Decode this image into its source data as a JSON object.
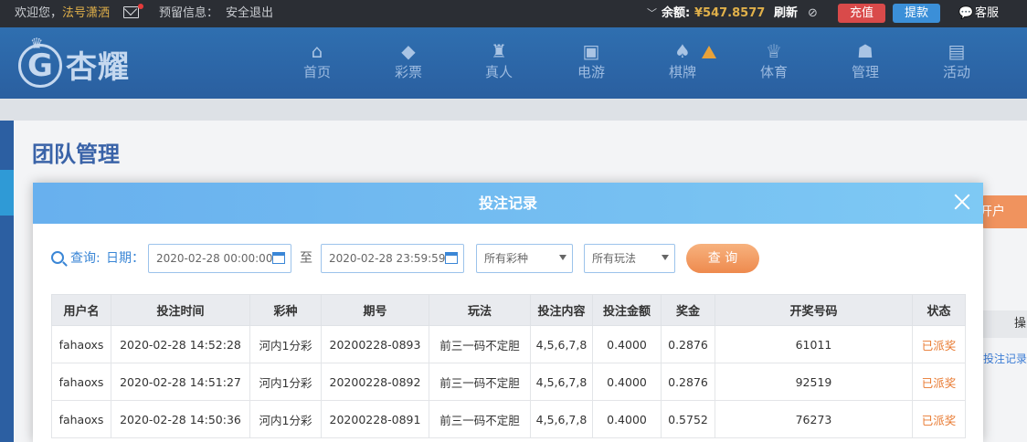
{
  "topbar": {
    "welcome": "欢迎您，",
    "username": "法号潇洒",
    "preview_info": "预留信息：",
    "logout": "安全退出",
    "balance_label": "余额:",
    "balance_value": "¥547.8577",
    "refresh": "刷新",
    "recharge": "充值",
    "withdraw": "提款",
    "service": "客服"
  },
  "logo": {
    "mark": "G",
    "text": "杏耀"
  },
  "nav": [
    {
      "label": "首页",
      "icon": "home-icon",
      "glyph": "⌂"
    },
    {
      "label": "彩票",
      "icon": "lottery-icon",
      "glyph": "◆"
    },
    {
      "label": "真人",
      "icon": "live-dealer-icon",
      "glyph": "♜"
    },
    {
      "label": "电游",
      "icon": "slot-machine-icon",
      "glyph": "▣"
    },
    {
      "label": "棋牌",
      "icon": "cards-icon",
      "glyph": "♠"
    },
    {
      "label": "体育",
      "icon": "trophy-icon",
      "glyph": "♕"
    },
    {
      "label": "管理",
      "icon": "users-icon",
      "glyph": "☗"
    },
    {
      "label": "活动",
      "icon": "gift-icon",
      "glyph": "▤"
    }
  ],
  "page": {
    "title": "团队管理",
    "bg_button": "开户",
    "bg_header": "操",
    "bg_link": "投注记录"
  },
  "modal": {
    "title": "投注记录",
    "filter": {
      "query_label": "查询:",
      "date_label": "日期：",
      "start": "2020-02-28 00:00:00",
      "to": "至",
      "end": "2020-02-28 23:59:59",
      "lottery_select": "所有彩种",
      "play_select": "所有玩法",
      "query_button": "查 询"
    },
    "table": {
      "headers": [
        "用户名",
        "投注时间",
        "彩种",
        "期号",
        "玩法",
        "投注内容",
        "投注金额",
        "奖金",
        "开奖号码",
        "状态"
      ],
      "rows": [
        [
          "fahaoxs",
          "2020-02-28 14:52:28",
          "河内1分彩",
          "20200228-0893",
          "前三一码不定胆",
          "4,5,6,7,8",
          "0.4000",
          "0.2876",
          "61011",
          "已派奖"
        ],
        [
          "fahaoxs",
          "2020-02-28 14:51:27",
          "河内1分彩",
          "20200228-0892",
          "前三一码不定胆",
          "4,5,6,7,8",
          "0.4000",
          "0.2876",
          "92519",
          "已派奖"
        ],
        [
          "fahaoxs",
          "2020-02-28 14:50:36",
          "河内1分彩",
          "20200228-0891",
          "前三一码不定胆",
          "4,5,6,7,8",
          "0.4000",
          "0.5752",
          "76273",
          "已派奖"
        ]
      ]
    }
  }
}
